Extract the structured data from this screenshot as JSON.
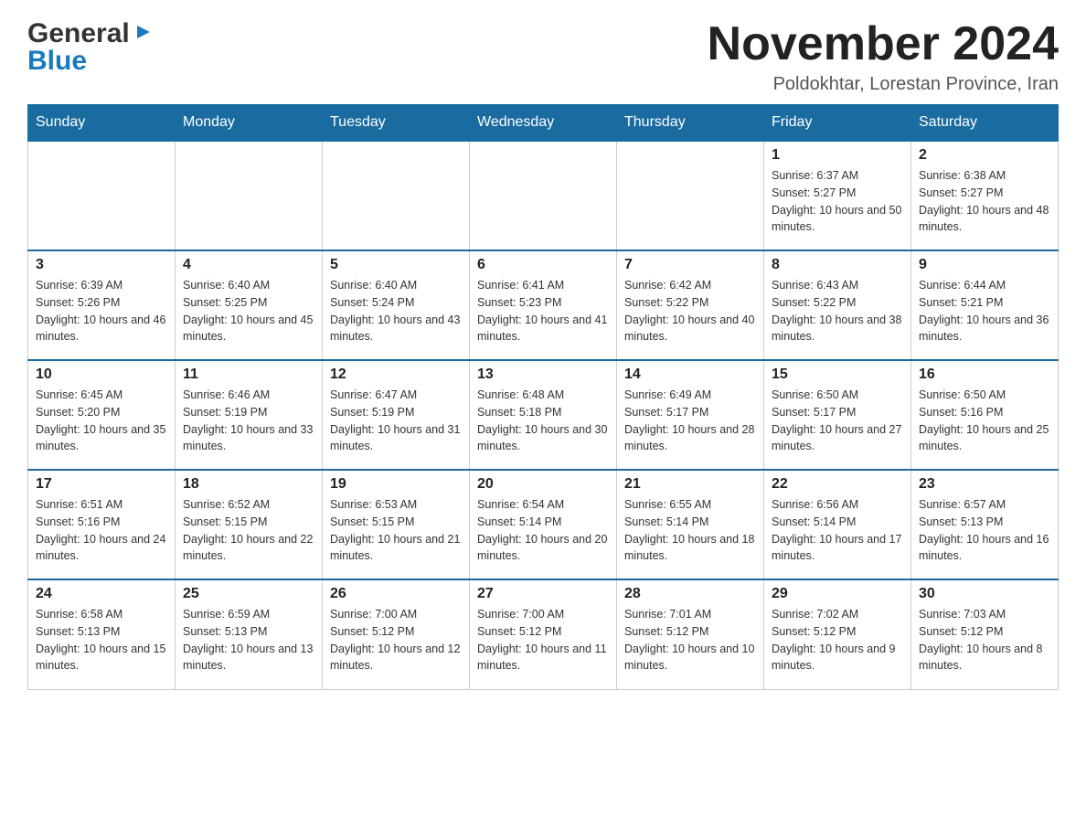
{
  "logo": {
    "general": "General",
    "blue": "Blue"
  },
  "header": {
    "month_year": "November 2024",
    "location": "Poldokhtar, Lorestan Province, Iran"
  },
  "weekdays": [
    "Sunday",
    "Monday",
    "Tuesday",
    "Wednesday",
    "Thursday",
    "Friday",
    "Saturday"
  ],
  "weeks": [
    {
      "days": [
        {
          "number": "",
          "info": ""
        },
        {
          "number": "",
          "info": ""
        },
        {
          "number": "",
          "info": ""
        },
        {
          "number": "",
          "info": ""
        },
        {
          "number": "",
          "info": ""
        },
        {
          "number": "1",
          "info": "Sunrise: 6:37 AM\nSunset: 5:27 PM\nDaylight: 10 hours and 50 minutes."
        },
        {
          "number": "2",
          "info": "Sunrise: 6:38 AM\nSunset: 5:27 PM\nDaylight: 10 hours and 48 minutes."
        }
      ]
    },
    {
      "days": [
        {
          "number": "3",
          "info": "Sunrise: 6:39 AM\nSunset: 5:26 PM\nDaylight: 10 hours and 46 minutes."
        },
        {
          "number": "4",
          "info": "Sunrise: 6:40 AM\nSunset: 5:25 PM\nDaylight: 10 hours and 45 minutes."
        },
        {
          "number": "5",
          "info": "Sunrise: 6:40 AM\nSunset: 5:24 PM\nDaylight: 10 hours and 43 minutes."
        },
        {
          "number": "6",
          "info": "Sunrise: 6:41 AM\nSunset: 5:23 PM\nDaylight: 10 hours and 41 minutes."
        },
        {
          "number": "7",
          "info": "Sunrise: 6:42 AM\nSunset: 5:22 PM\nDaylight: 10 hours and 40 minutes."
        },
        {
          "number": "8",
          "info": "Sunrise: 6:43 AM\nSunset: 5:22 PM\nDaylight: 10 hours and 38 minutes."
        },
        {
          "number": "9",
          "info": "Sunrise: 6:44 AM\nSunset: 5:21 PM\nDaylight: 10 hours and 36 minutes."
        }
      ]
    },
    {
      "days": [
        {
          "number": "10",
          "info": "Sunrise: 6:45 AM\nSunset: 5:20 PM\nDaylight: 10 hours and 35 minutes."
        },
        {
          "number": "11",
          "info": "Sunrise: 6:46 AM\nSunset: 5:19 PM\nDaylight: 10 hours and 33 minutes."
        },
        {
          "number": "12",
          "info": "Sunrise: 6:47 AM\nSunset: 5:19 PM\nDaylight: 10 hours and 31 minutes."
        },
        {
          "number": "13",
          "info": "Sunrise: 6:48 AM\nSunset: 5:18 PM\nDaylight: 10 hours and 30 minutes."
        },
        {
          "number": "14",
          "info": "Sunrise: 6:49 AM\nSunset: 5:17 PM\nDaylight: 10 hours and 28 minutes."
        },
        {
          "number": "15",
          "info": "Sunrise: 6:50 AM\nSunset: 5:17 PM\nDaylight: 10 hours and 27 minutes."
        },
        {
          "number": "16",
          "info": "Sunrise: 6:50 AM\nSunset: 5:16 PM\nDaylight: 10 hours and 25 minutes."
        }
      ]
    },
    {
      "days": [
        {
          "number": "17",
          "info": "Sunrise: 6:51 AM\nSunset: 5:16 PM\nDaylight: 10 hours and 24 minutes."
        },
        {
          "number": "18",
          "info": "Sunrise: 6:52 AM\nSunset: 5:15 PM\nDaylight: 10 hours and 22 minutes."
        },
        {
          "number": "19",
          "info": "Sunrise: 6:53 AM\nSunset: 5:15 PM\nDaylight: 10 hours and 21 minutes."
        },
        {
          "number": "20",
          "info": "Sunrise: 6:54 AM\nSunset: 5:14 PM\nDaylight: 10 hours and 20 minutes."
        },
        {
          "number": "21",
          "info": "Sunrise: 6:55 AM\nSunset: 5:14 PM\nDaylight: 10 hours and 18 minutes."
        },
        {
          "number": "22",
          "info": "Sunrise: 6:56 AM\nSunset: 5:14 PM\nDaylight: 10 hours and 17 minutes."
        },
        {
          "number": "23",
          "info": "Sunrise: 6:57 AM\nSunset: 5:13 PM\nDaylight: 10 hours and 16 minutes."
        }
      ]
    },
    {
      "days": [
        {
          "number": "24",
          "info": "Sunrise: 6:58 AM\nSunset: 5:13 PM\nDaylight: 10 hours and 15 minutes."
        },
        {
          "number": "25",
          "info": "Sunrise: 6:59 AM\nSunset: 5:13 PM\nDaylight: 10 hours and 13 minutes."
        },
        {
          "number": "26",
          "info": "Sunrise: 7:00 AM\nSunset: 5:12 PM\nDaylight: 10 hours and 12 minutes."
        },
        {
          "number": "27",
          "info": "Sunrise: 7:00 AM\nSunset: 5:12 PM\nDaylight: 10 hours and 11 minutes."
        },
        {
          "number": "28",
          "info": "Sunrise: 7:01 AM\nSunset: 5:12 PM\nDaylight: 10 hours and 10 minutes."
        },
        {
          "number": "29",
          "info": "Sunrise: 7:02 AM\nSunset: 5:12 PM\nDaylight: 10 hours and 9 minutes."
        },
        {
          "number": "30",
          "info": "Sunrise: 7:03 AM\nSunset: 5:12 PM\nDaylight: 10 hours and 8 minutes."
        }
      ]
    }
  ]
}
